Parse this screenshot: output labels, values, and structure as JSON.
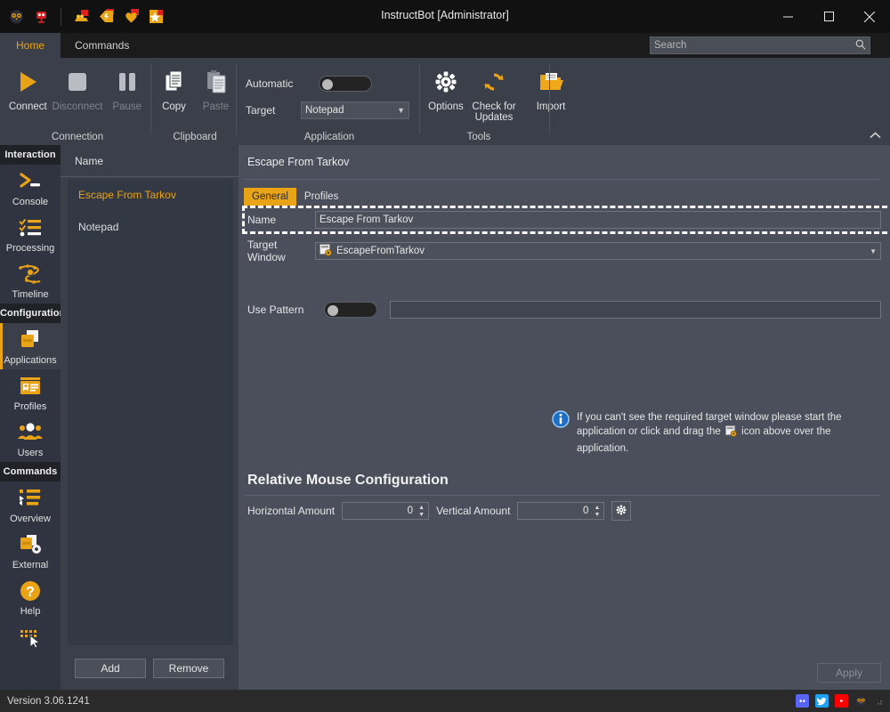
{
  "window": {
    "title": "InstructBot [Administrator]",
    "minimize": "—",
    "maximize": "☐",
    "close": "✕",
    "quick_access": [
      "owl-logo-icon",
      "red-bot-icon",
      "treasure-icon",
      "tag-icon",
      "heart-icon",
      "star-icon"
    ]
  },
  "search": {
    "placeholder": "Search",
    "value": "",
    "icon": "search-icon"
  },
  "ribbon": {
    "tabs": [
      {
        "label": "Home",
        "active": true
      },
      {
        "label": "Commands",
        "active": false
      }
    ],
    "collapse_chevron": "⌃",
    "groups": [
      {
        "label": "Connection",
        "buttons": [
          {
            "label": "Connect",
            "icon": "play-icon",
            "disabled": false
          },
          {
            "label": "Disconnect",
            "icon": "stop-icon",
            "disabled": true
          },
          {
            "label": "Pause",
            "icon": "pause-icon",
            "disabled": true
          }
        ]
      },
      {
        "label": "Clipboard",
        "buttons": [
          {
            "label": "Copy",
            "icon": "copy-icon",
            "disabled": false
          },
          {
            "label": "Paste",
            "icon": "paste-icon",
            "disabled": true
          }
        ]
      },
      {
        "label": "Application",
        "fields": {
          "automatic_label": "Automatic",
          "automatic_on": false,
          "target_label": "Target",
          "target_value": "Notepad"
        }
      },
      {
        "label": "Tools",
        "buttons": [
          {
            "label": "Options",
            "icon": "gear-icon",
            "disabled": false
          },
          {
            "label": "Check for Updates",
            "icon": "refresh-icon",
            "disabled": false
          },
          {
            "label": "Import",
            "icon": "folder-open-icon",
            "disabled": false
          }
        ]
      }
    ]
  },
  "sidebar": {
    "sections": [
      {
        "header": "Interaction",
        "items": [
          {
            "label": "Console",
            "icon": "terminal-icon",
            "active": false
          },
          {
            "label": "Processing",
            "icon": "checklist-icon",
            "active": false
          },
          {
            "label": "Timeline",
            "icon": "timeline-icon",
            "active": false
          }
        ]
      },
      {
        "header": "Configuration",
        "items": [
          {
            "label": "Applications",
            "icon": "applications-icon",
            "active": true
          },
          {
            "label": "Profiles",
            "icon": "id-card-icon",
            "active": false
          },
          {
            "label": "Users",
            "icon": "users-icon",
            "active": false
          }
        ]
      },
      {
        "header": "Commands",
        "items": [
          {
            "label": "Overview",
            "icon": "list-overview-icon",
            "active": false
          },
          {
            "label": "External",
            "icon": "external-gear-icon",
            "active": false
          },
          {
            "label": "Help",
            "icon": "question-circle-icon",
            "active": false
          },
          {
            "label": "",
            "icon": "keyboard-cursor-icon",
            "active": false
          }
        ]
      }
    ]
  },
  "list_panel": {
    "column_header": "Name",
    "rows": [
      {
        "name": "Escape From Tarkov",
        "selected": true
      },
      {
        "name": "Notepad",
        "selected": false
      }
    ],
    "add_label": "Add",
    "remove_label": "Remove"
  },
  "main": {
    "heading": "Escape From Tarkov",
    "tabs": [
      {
        "label": "General",
        "active": true
      },
      {
        "label": "Profiles",
        "active": false
      }
    ],
    "name_label": "Name",
    "name_value": "Escape From Tarkov",
    "target_window_label": "Target Window",
    "target_window_value": "EscapeFromTarkov",
    "target_window_icon": "window-target-icon",
    "info_icon": "info-icon",
    "info_message_part1": "If you can't see the required target window please start the application or click and drag the",
    "info_message_part2": "icon above over the application.",
    "use_pattern_label": "Use Pattern",
    "use_pattern_on": false,
    "use_pattern_value": "",
    "section_title": "Relative Mouse Configuration",
    "horizontal_label": "Horizontal Amount",
    "horizontal_value": "0",
    "vertical_label": "Vertical Amount",
    "vertical_value": "0",
    "settings_icon": "gear-icon",
    "apply_label": "Apply"
  },
  "status": {
    "version": "Version 3.06.1241",
    "icons": [
      "discord-icon",
      "twitter-icon",
      "youtube-icon",
      "owl-logo-icon"
    ],
    "resize_grip": "resize-grip-icon"
  },
  "colors": {
    "accent": "#e8a317",
    "titlebar_bg": "#111111",
    "ribbon_bg": "#3a3f49",
    "sidebar_bg": "#303440",
    "content_bg": "#4a4f5b",
    "status_bg": "#2a2a2a",
    "highlight_border": "#ffffff"
  }
}
